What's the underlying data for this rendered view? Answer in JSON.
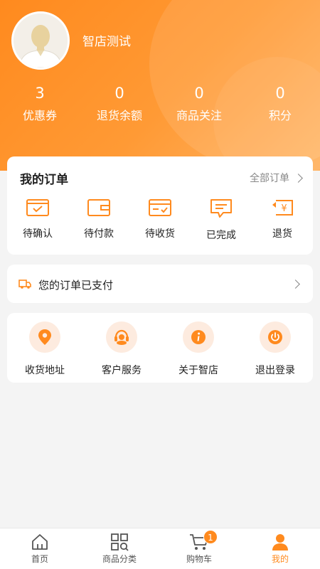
{
  "profile": {
    "shop_name": "智店测试"
  },
  "stats": [
    {
      "value": "3",
      "label": "优惠券"
    },
    {
      "value": "0",
      "label": "退货余额"
    },
    {
      "value": "0",
      "label": "商品关注"
    },
    {
      "value": "0",
      "label": "积分"
    }
  ],
  "orders": {
    "title": "我的订单",
    "all_label": "全部订单",
    "items": [
      {
        "label": "待确认",
        "icon": "pending-confirm-icon"
      },
      {
        "label": "待付款",
        "icon": "wallet-icon"
      },
      {
        "label": "待收货",
        "icon": "delivery-card-icon"
      },
      {
        "label": "已完成",
        "icon": "message-icon"
      },
      {
        "label": "退货",
        "icon": "refund-icon"
      }
    ]
  },
  "notice": {
    "text": "您的订单已支付",
    "icon": "truck-icon"
  },
  "services": [
    {
      "label": "收货地址",
      "icon": "location-pin-icon"
    },
    {
      "label": "客户服务",
      "icon": "customer-service-icon"
    },
    {
      "label": "关于智店",
      "icon": "info-icon"
    },
    {
      "label": "退出登录",
      "icon": "power-icon"
    }
  ],
  "tabbar": {
    "items": [
      {
        "label": "首页",
        "icon": "home-icon"
      },
      {
        "label": "商品分类",
        "icon": "category-icon"
      },
      {
        "label": "购物车",
        "icon": "cart-icon",
        "badge": "1"
      },
      {
        "label": "我的",
        "icon": "user-icon",
        "active": true
      }
    ]
  },
  "colors": {
    "accent": "#ff8a1e",
    "icon_bg": "#fdebdf",
    "page_bg": "#f4f4f4"
  }
}
